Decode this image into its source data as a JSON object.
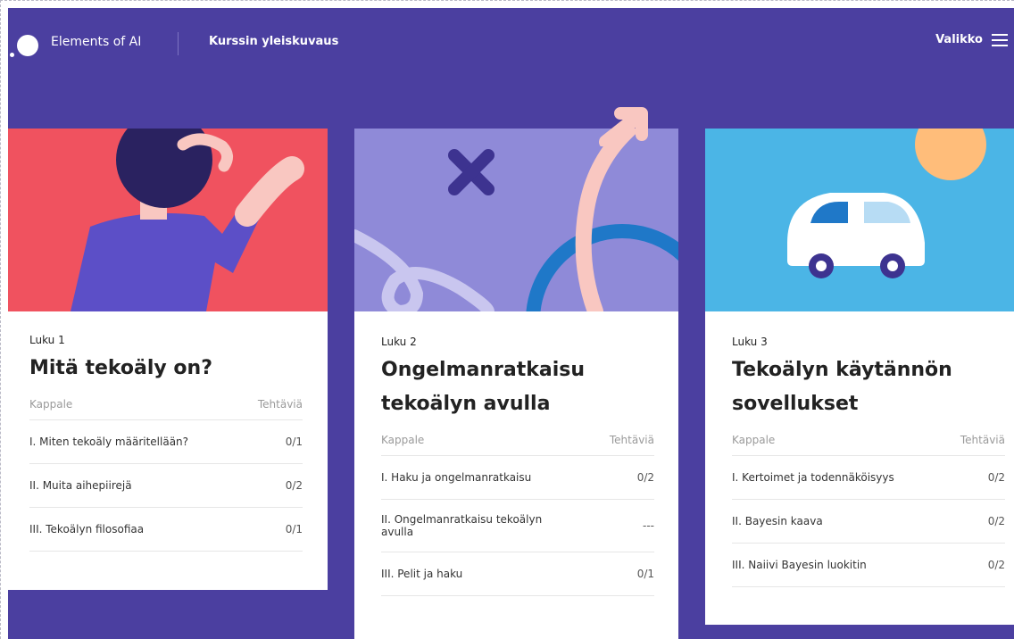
{
  "header": {
    "brand": "Elements of AI",
    "breadcrumb": "Kurssin yleiskuvaus",
    "menu_label": "Valikko"
  },
  "colors": {
    "background": "#4b3fa0",
    "card1_hero": "#f0525f",
    "card2_hero": "#8f8ad8",
    "card3_hero": "#4bb5e6",
    "sun": "#ffbd7a",
    "figure_shirt": "#5c4fc7"
  },
  "icons": [
    "logo-circle-icon",
    "hamburger-menu-icon"
  ],
  "cards": [
    {
      "chapter": "Luku 1",
      "title": "Mitä tekoäly on?",
      "col_section": "Kappale",
      "col_exercises": "Tehtäviä",
      "rows": [
        {
          "label": "I. Miten tekoäly määritellään?",
          "score": "0/1"
        },
        {
          "label": "II. Muita aihepiirejä",
          "score": "0/2"
        },
        {
          "label": "III. Tekoälyn filosofiaa",
          "score": "0/1"
        }
      ]
    },
    {
      "chapter": "Luku 2",
      "title": "Ongelmanratkaisu tekoälyn avulla",
      "col_section": "Kappale",
      "col_exercises": "Tehtäviä",
      "rows": [
        {
          "label": "I. Haku ja ongelmanratkaisu",
          "score": "0/2"
        },
        {
          "label": "II. Ongelmanratkaisu tekoälyn avulla",
          "score": "---"
        },
        {
          "label": "III. Pelit ja haku",
          "score": "0/1"
        }
      ]
    },
    {
      "chapter": "Luku 3",
      "title": "Tekoälyn käytännön sovellukset",
      "col_section": "Kappale",
      "col_exercises": "Tehtäviä",
      "rows": [
        {
          "label": "I. Kertoimet ja todennäköisyys",
          "score": "0/2"
        },
        {
          "label": "II. Bayesin kaava",
          "score": "0/2"
        },
        {
          "label": "III. Naiivi Bayesin luokitin",
          "score": "0/2"
        }
      ]
    }
  ]
}
